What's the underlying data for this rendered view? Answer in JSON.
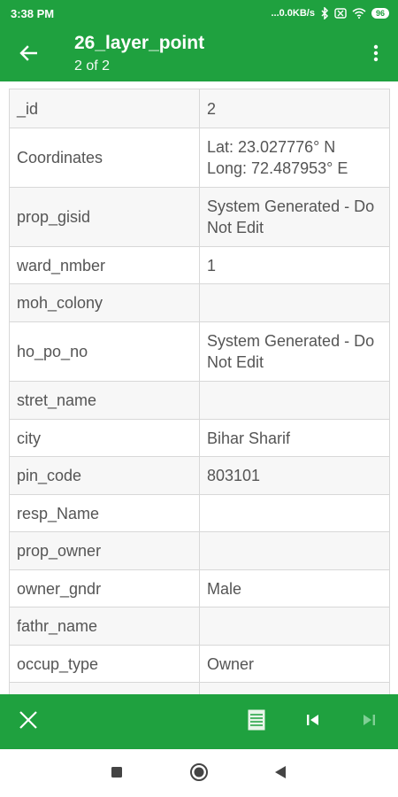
{
  "status_bar": {
    "time": "3:38 PM",
    "network_speed": "...0.0KB/s",
    "battery": "96"
  },
  "header": {
    "title": "26_layer_point",
    "subtitle": "2 of 2"
  },
  "attributes": [
    {
      "key": "_id",
      "value": "2"
    },
    {
      "key": "Coordinates",
      "value": "Lat: 23.027776° N\nLong: 72.487953° E"
    },
    {
      "key": "prop_gisid",
      "value": "System Generated - Do Not Edit"
    },
    {
      "key": "ward_nmber",
      "value": "1"
    },
    {
      "key": "moh_colony",
      "value": ""
    },
    {
      "key": "ho_po_no",
      "value": "System Generated - Do Not Edit"
    },
    {
      "key": "stret_name",
      "value": ""
    },
    {
      "key": "city",
      "value": "Bihar Sharif"
    },
    {
      "key": "pin_code",
      "value": "803101"
    },
    {
      "key": "resp_Name",
      "value": ""
    },
    {
      "key": "prop_owner",
      "value": ""
    },
    {
      "key": "owner_gndr",
      "value": "Male"
    },
    {
      "key": "fathr_name",
      "value": ""
    },
    {
      "key": "occup_type",
      "value": "Owner"
    },
    {
      "key": "",
      "value": ""
    }
  ],
  "icons": {
    "back": "arrow-back-icon",
    "menu": "more-vert-icon",
    "close": "close-icon",
    "table": "table-icon",
    "first": "skip-previous-icon",
    "last": "skip-next-icon"
  },
  "colors": {
    "primary": "#1fa13f",
    "row_alt": "#f7f7f7",
    "text": "#555555"
  }
}
